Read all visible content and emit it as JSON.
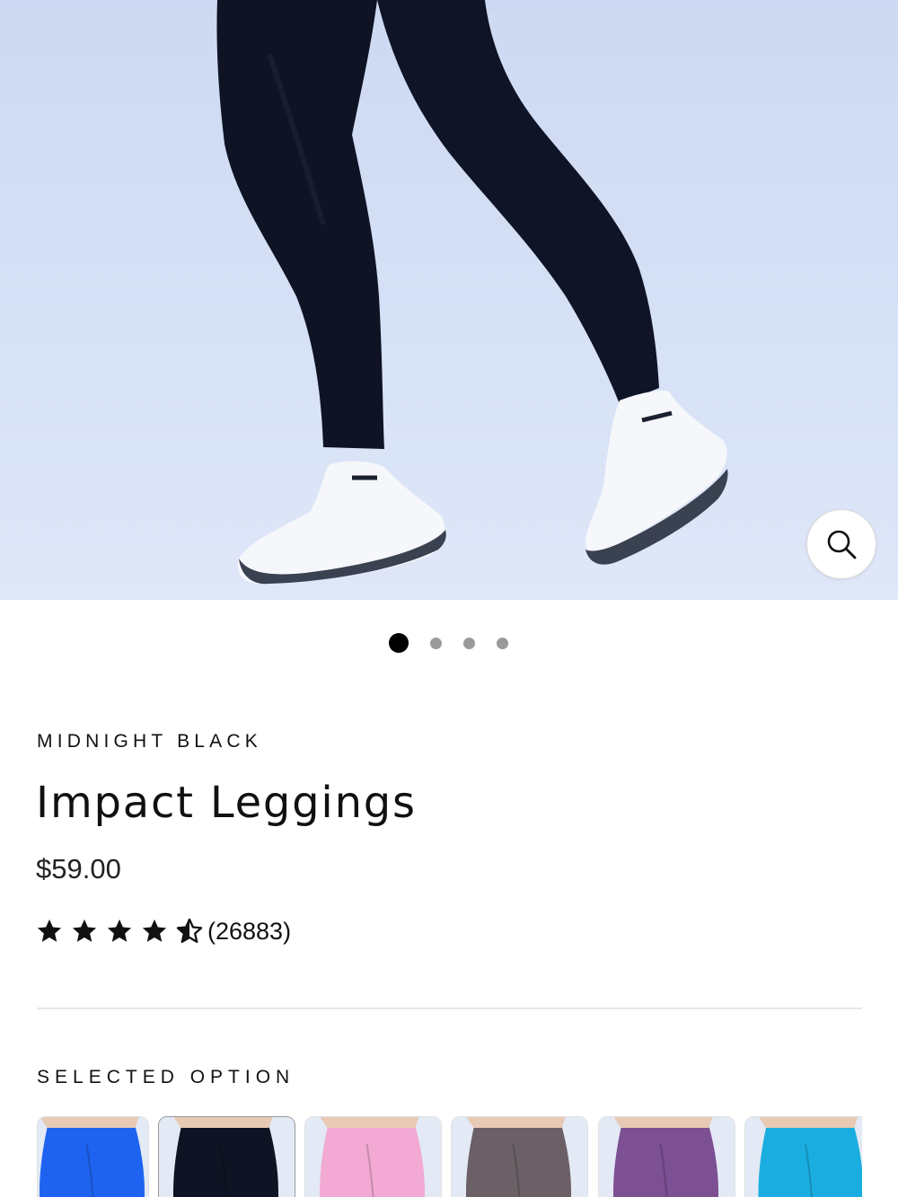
{
  "gallery": {
    "slide_count": 4,
    "active_slide": 1,
    "zoom_icon": "search-icon"
  },
  "product": {
    "variant": "MIDNIGHT BLACK",
    "title": "Impact Leggings",
    "price": "$59.00",
    "rating": 4.5,
    "rating_max": 5,
    "review_count": "(26883)"
  },
  "options": {
    "label": "SELECTED OPTION",
    "swatches": [
      {
        "color_name": "blue",
        "color": "#1e63f0",
        "selected": false
      },
      {
        "color_name": "black",
        "color": "#0f1424",
        "selected": true
      },
      {
        "color_name": "pink",
        "color": "#f2a9d4",
        "selected": false
      },
      {
        "color_name": "taupe",
        "color": "#6b6066",
        "selected": false
      },
      {
        "color_name": "purple",
        "color": "#7d4f93",
        "selected": false
      },
      {
        "color_name": "aqua",
        "color": "#1aaee0",
        "selected": false
      }
    ]
  },
  "colors": {
    "leggings": "#0e1424",
    "sneaker": "#f7f8fb",
    "sneaker_sole": "#3a4150"
  }
}
